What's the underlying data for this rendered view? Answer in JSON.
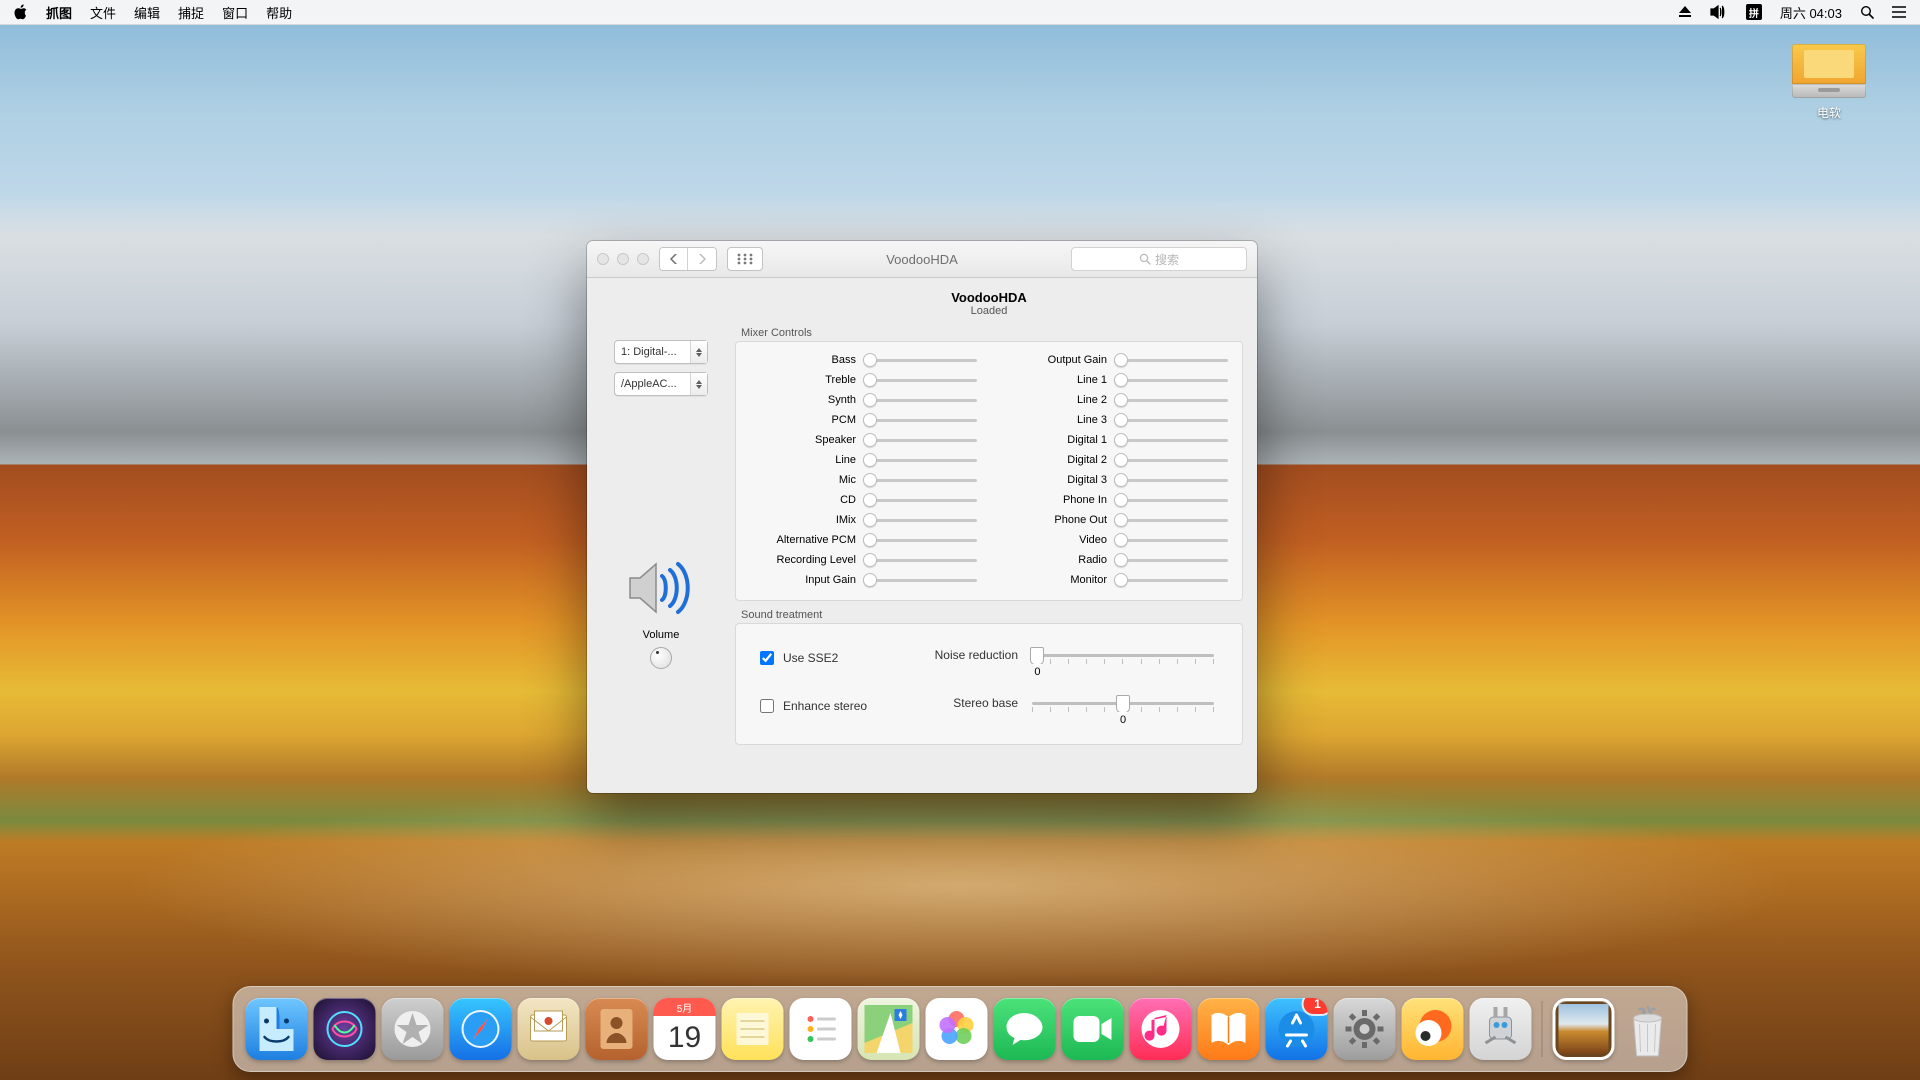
{
  "menubar": {
    "app": "抓图",
    "items": [
      "文件",
      "编辑",
      "捕捉",
      "窗口",
      "帮助"
    ],
    "right": {
      "ime": "拼",
      "clock": "周六 04:03"
    }
  },
  "desktop": {
    "drive_label": "电软"
  },
  "window": {
    "title": "VoodooHDA",
    "search_placeholder": "搜索",
    "header_title": "VoodooHDA",
    "header_status": "Loaded",
    "selectors": {
      "device": "1: Digital-...",
      "path": "/AppleAC..."
    },
    "volume_label": "Volume",
    "mixer_label": "Mixer Controls",
    "mixer_left": [
      "Bass",
      "Treble",
      "Synth",
      "PCM",
      "Speaker",
      "Line",
      "Mic",
      "CD",
      "IMix",
      "Alternative PCM",
      "Recording Level",
      "Input Gain"
    ],
    "mixer_right": [
      "Output Gain",
      "Line 1",
      "Line 2",
      "Line 3",
      "Digital 1",
      "Digital 2",
      "Digital 3",
      "Phone In",
      "Phone Out",
      "Video",
      "Radio",
      "Monitor"
    ],
    "sound_label": "Sound treatment",
    "chk_sse2": "Use SSE2",
    "chk_enhance": "Enhance stereo",
    "noise_label": "Noise reduction",
    "noise_value": "0",
    "stereo_label": "Stereo base",
    "stereo_value": "0"
  },
  "dock": {
    "appstore_badge": "1",
    "calendar": {
      "month": "5月",
      "day": "19"
    },
    "items": [
      "finder",
      "siri",
      "launchpad",
      "safari",
      "mail",
      "contacts",
      "calendar",
      "notes",
      "reminders",
      "maps",
      "photos",
      "messages",
      "facetime",
      "itunes",
      "ibooks",
      "appstore",
      "system-preferences",
      "weibo",
      "automator"
    ],
    "right_items": [
      "desktop-preview",
      "trash"
    ]
  }
}
